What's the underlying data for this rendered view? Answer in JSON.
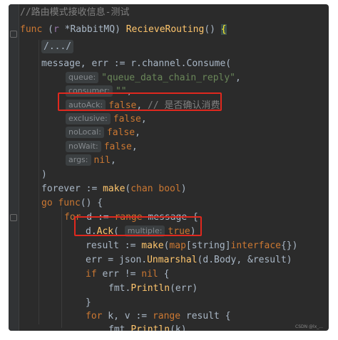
{
  "editor": {
    "comment_line": "//路由模式接收信息-测试",
    "func_kw": "func",
    "recv_open": "(",
    "recv_name": "r",
    "recv_type": "*RabbitMQ)",
    "func_name": "RecieveRouting",
    "func_tail": "()",
    "open_brace": "{",
    "folded_block": "/.../",
    "consume_lhs": "message, err := r.channel.",
    "consume_fn": "Consume",
    "consume_paren": "(",
    "params": [
      {
        "hint": "queue:",
        "value": "\"queue_data_chain_reply\"",
        "tail": ","
      },
      {
        "hint": "consumer:",
        "value": "\"\"",
        "tail": ","
      },
      {
        "hint": "autoAck:",
        "value": "false",
        "tail": ",",
        "comment": "// 是否确认消费"
      },
      {
        "hint": "exclusive:",
        "value": "false",
        "tail": ","
      },
      {
        "hint": "noLocal:",
        "value": "false",
        "tail": ","
      },
      {
        "hint": "noWait:",
        "value": "false",
        "tail": ","
      },
      {
        "hint": "args:",
        "value": "nil",
        "tail": ","
      }
    ],
    "close_paren": ")",
    "forever_lhs": "forever := ",
    "make_fn": "make",
    "chan_open": "(",
    "chan_kw": "chan bool",
    "chan_close": ")",
    "go_kw": "go func",
    "go_tail": "() {",
    "for_kw": "for",
    "for_var": " d := ",
    "range_kw": "range",
    "for_tail": " message {",
    "ack_recv": "d.",
    "ack_fn": "Ack",
    "ack_open": "(",
    "ack_hint": "multiple:",
    "ack_value": "true",
    "ack_close": ")",
    "result_lhs": "result := ",
    "result_open": "(",
    "map_kw": "map",
    "map_key": "[string]",
    "iface_kw": "interface",
    "result_tail": "{})",
    "unmarshal_lhs": "err = json.",
    "unmarshal_fn": "Unmarshal",
    "unmarshal_args": "(d.Body, &result)",
    "if_kw": "if",
    "if_mid": " err != ",
    "nil_kw": "nil",
    "if_tail": " {",
    "println1_obj": "fmt.",
    "println_fn": "Println",
    "println1_args": "(err)",
    "close_block": "}",
    "for2_kw": "for",
    "for2_var": " k, v := ",
    "range2_kw": "range",
    "for2_tail": " result {",
    "println2_obj": "fmt.",
    "println2_args": "(k)",
    "cut_line": "// ... ... ... ...",
    "watermark": "CSDN @lx_..."
  }
}
